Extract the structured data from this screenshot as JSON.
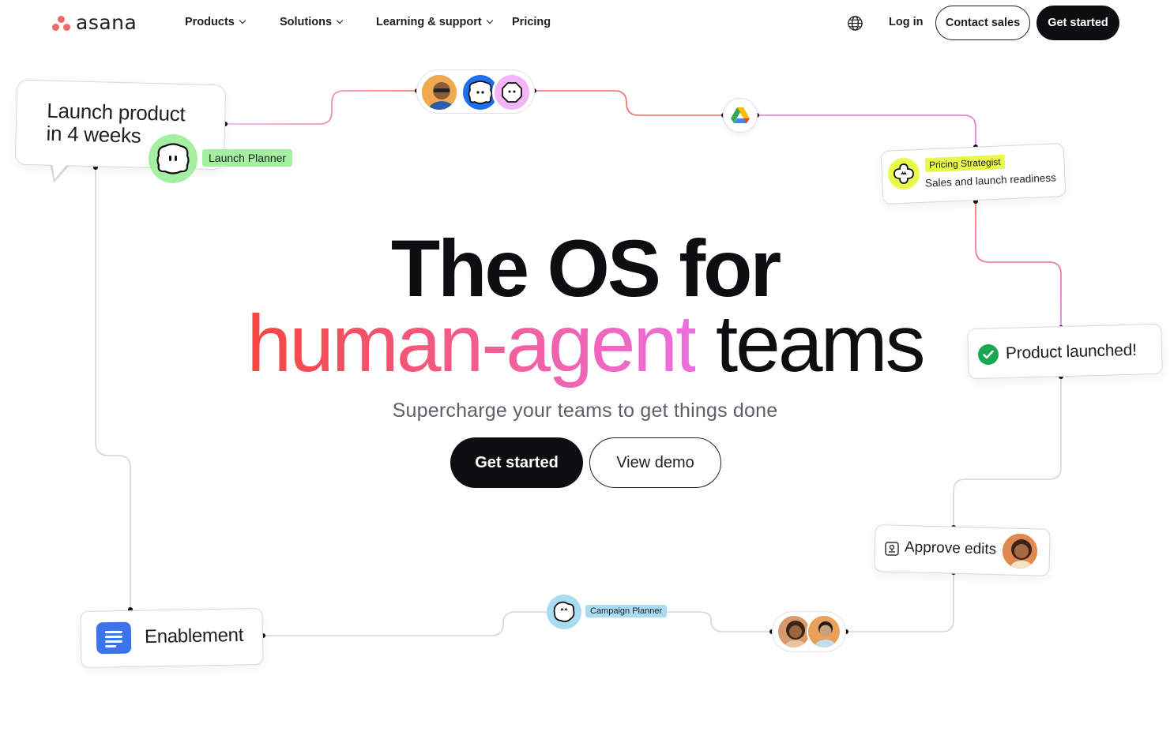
{
  "brand": {
    "name": "asana",
    "accent": "#f06a6a"
  },
  "nav": {
    "items": [
      {
        "label": "Products",
        "has_dropdown": true
      },
      {
        "label": "Solutions",
        "has_dropdown": true
      },
      {
        "label": "Learning & support",
        "has_dropdown": true
      },
      {
        "label": "Pricing",
        "has_dropdown": false
      }
    ],
    "language_icon": "globe-icon",
    "login": "Log in",
    "contact_sales": "Contact sales",
    "get_started": "Get started"
  },
  "hero": {
    "line1": "The OS for",
    "line2_highlight": "human-agent",
    "line2_rest": "teams",
    "subtitle": "Supercharge your teams to get things done",
    "primary_cta": "Get started",
    "secondary_cta": "View demo",
    "gradient": [
      "#f6463f",
      "#f45a86",
      "#ec6fe0"
    ]
  },
  "diagram": {
    "speech_bubble": {
      "line1": "Launch product",
      "line2": "in 4 weeks"
    },
    "launch_planner": {
      "tag": "Launch Planner",
      "color": "#a5f0a0"
    },
    "pricing_strategist": {
      "tag": "Pricing Strategist",
      "subtitle": "Sales and launch readiness",
      "color": "#e9f94b"
    },
    "product_launched": {
      "label": "Product launched!",
      "check_color": "#1aa653"
    },
    "approve_edits": {
      "label": "Approve edits"
    },
    "campaign_planner": {
      "tag": "Campaign Planner",
      "color": "#a9dcf2"
    },
    "enablement": {
      "label": "Enablement",
      "icon": "document-icon"
    },
    "integration_icon": "google-drive-icon"
  }
}
